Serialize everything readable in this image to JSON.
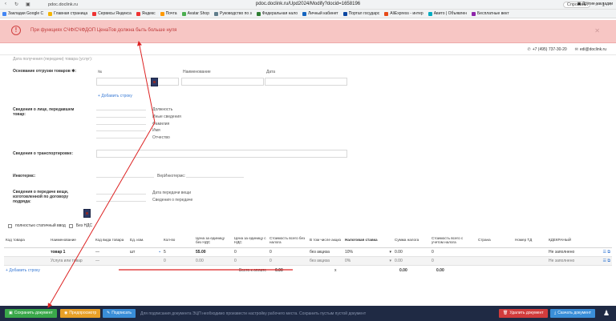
{
  "browser": {
    "page_title": "pdoc.doclink.ru/Upd2024/Modify?docid=1658196",
    "address": "pdoc.doclink.ru",
    "ask_label": "Спросить",
    "bookmarks": [
      {
        "label": "Закладки Google C",
        "color": "#4285f4"
      },
      {
        "label": "Главная страница",
        "color": "#f4b400"
      },
      {
        "label": "Сервисы Яндекса",
        "color": "#e33"
      },
      {
        "label": "Яндекс",
        "color": "#e33"
      },
      {
        "label": "Почта",
        "color": "#f90"
      },
      {
        "label": "Avatar Shop",
        "color": "#4caf50"
      },
      {
        "label": "Руководство по з",
        "color": "#607d8b"
      },
      {
        "label": "Федеральная нало",
        "color": "#2e7d32"
      },
      {
        "label": "Личный кабинет",
        "color": "#1565c0"
      },
      {
        "label": "Портал государс",
        "color": "#0d47a1"
      },
      {
        "label": "AliExpress - интер",
        "color": "#e64a19"
      },
      {
        "label": "Авито | Объявлен",
        "color": "#00acc1"
      },
      {
        "label": "Бесплатные вект",
        "color": "#8e24aa"
      }
    ],
    "bookmarks_right": "Другие закладки"
  },
  "banner": {
    "message": "При функциях СЧФ/СЧФДОП ЦенаТов должна быть больше нуля",
    "close_icon": "close-icon"
  },
  "contacts": {
    "phone": "+7 (495) 737-30-20",
    "email": "edi@doclink.ru"
  },
  "form": {
    "top_cut_label": "Дата получения (передачи) товара (услуг):",
    "shipment_basis_label": "Основание отгрузки товаров ✱:",
    "col_no": "№",
    "col_name": "Наименование",
    "col_date": "Дата",
    "add_row": "Добавить строку",
    "transfer_person_label": "Сведения о лице, передавшем товар:",
    "person_fields": [
      "Должность",
      "Иные сведения",
      "Фамилия",
      "Имя",
      "Отчество"
    ],
    "transport_label": "Сведения о транспортировке:",
    "incoterms_label": "Инкотермс:",
    "incoterms_version_label": "ВерИнкотермс:",
    "transfer_info_label": "Сведения о передаче вещи, изготовленной по договору подряда:",
    "transfer_date_label": "Дата передачи вещи",
    "transfer_info_field": "Сведения о передаче",
    "checkbox_manual": "полностью статичный ввод",
    "checkbox_no_vat": "Без НДС"
  },
  "table": {
    "headers": [
      "Код товара",
      "Наименование",
      "Код вида товара",
      "Ед. изм.",
      "Кол-во",
      "Цена за единицу без НДС",
      "Цена за единицу с НДС",
      "Стоимость всего без налога",
      "В том числе акциз",
      "Налоговая ставка",
      "Сумма налога",
      "Стоимость всего с учетом налога",
      "Страна",
      "Номер ТД",
      "КДЕКРАНЫЙ"
    ],
    "rows": [
      [
        "",
        "товар 1",
        "—",
        "шт",
        "5",
        "55.00",
        "0",
        "0",
        "без акциза",
        "10%",
        "0.00",
        "0",
        "",
        "",
        "Не заполнено"
      ],
      [
        "",
        "Услуга или товар",
        "—",
        "",
        "0",
        "0.00",
        "0",
        "0",
        "без акциза",
        "0%",
        "0.00",
        "0",
        "",
        "",
        "Не заполнено"
      ]
    ],
    "add_row": "Добавить строку",
    "total_label": "Всего к оплате",
    "total_values": [
      "0.00",
      "x",
      "0.00",
      "0.00"
    ]
  },
  "footer": {
    "save": "Сохранить документ",
    "preview": "Предпросмотр",
    "sign": "Подписать",
    "hint": "Для подписания документа ЭЦП необходимо произвести настройку рабочего места. Сохранить пустым пустой документ",
    "delete": "Удалить документ",
    "download": "Скачать документ",
    "colors": {
      "save": "#3aa84a",
      "preview": "#e8a027",
      "sign": "#3a8ed8",
      "delete": "#d23c3c",
      "download": "#3a8ed8"
    }
  }
}
